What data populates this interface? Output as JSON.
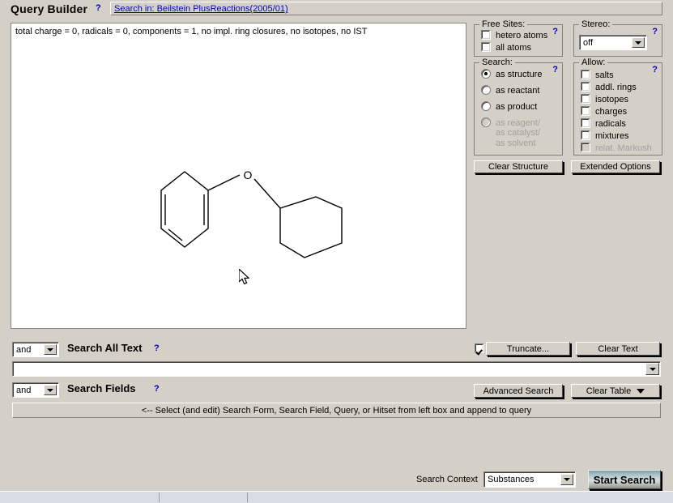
{
  "header": {
    "title": "Query Builder",
    "help": "?",
    "search_in": "Search in: Beilstein PlusReactions(2005/01)"
  },
  "structure": {
    "info_line": "total charge = 0, radicals = 0, components = 1, no impl. ring closures, no isotopes, no IST",
    "atom_label_o": "O"
  },
  "free_sites": {
    "legend": "Free Sites:",
    "help": "?",
    "items": [
      {
        "label": "hetero atoms",
        "checked": false,
        "disabled": false
      },
      {
        "label": "all atoms",
        "checked": false,
        "disabled": false
      }
    ]
  },
  "search_mode": {
    "legend": "Search:",
    "help": "?",
    "options": [
      {
        "label": "as structure",
        "selected": true,
        "disabled": false
      },
      {
        "label": "as reactant",
        "selected": false,
        "disabled": false
      },
      {
        "label": "as product",
        "selected": false,
        "disabled": false
      },
      {
        "label": "as reagent/",
        "selected": false,
        "disabled": true
      },
      {
        "label": "as catalyst/",
        "selected": false,
        "disabled": true,
        "no_control": true
      },
      {
        "label": "as solvent",
        "selected": false,
        "disabled": true,
        "no_control": true
      }
    ]
  },
  "stereo": {
    "legend": "Stereo:",
    "help": "?",
    "value": "off"
  },
  "allow": {
    "legend": "Allow:",
    "help": "?",
    "items": [
      {
        "label": "salts",
        "checked": false,
        "disabled": false
      },
      {
        "label": "addl. rings",
        "checked": false,
        "disabled": false
      },
      {
        "label": "isotopes",
        "checked": false,
        "disabled": false
      },
      {
        "label": "charges",
        "checked": false,
        "disabled": false
      },
      {
        "label": "radicals",
        "checked": false,
        "disabled": false
      },
      {
        "label": "mixtures",
        "checked": false,
        "disabled": false
      },
      {
        "label": "relat. Markush",
        "checked": false,
        "disabled": true
      }
    ]
  },
  "buttons": {
    "clear_structure": "Clear Structure",
    "extended_options": "Extended Options",
    "truncate": "Truncate...",
    "clear_text": "Clear Text",
    "advanced_search": "Advanced Search",
    "clear_table": "Clear Table",
    "start_search": "Start Search"
  },
  "search_all_text": {
    "operator": "and",
    "label": "Search All Text",
    "help": "?",
    "truncate_checked": true,
    "input_value": ""
  },
  "search_fields": {
    "operator": "and",
    "label": "Search Fields",
    "help": "?",
    "hint": "<-- Select (and edit) Search Form, Search Field, Query, or Hitset from left box and append to query"
  },
  "footer": {
    "search_context_label": "Search Context",
    "search_context_value": "Substances"
  },
  "colors": {
    "face": "#d4d0c8",
    "link": "#0000cc",
    "help": "#0000bb",
    "disabled_text": "#a0a0a0",
    "status_bar": "#d8dde4",
    "start_button_accent": "#7f9fa8"
  }
}
